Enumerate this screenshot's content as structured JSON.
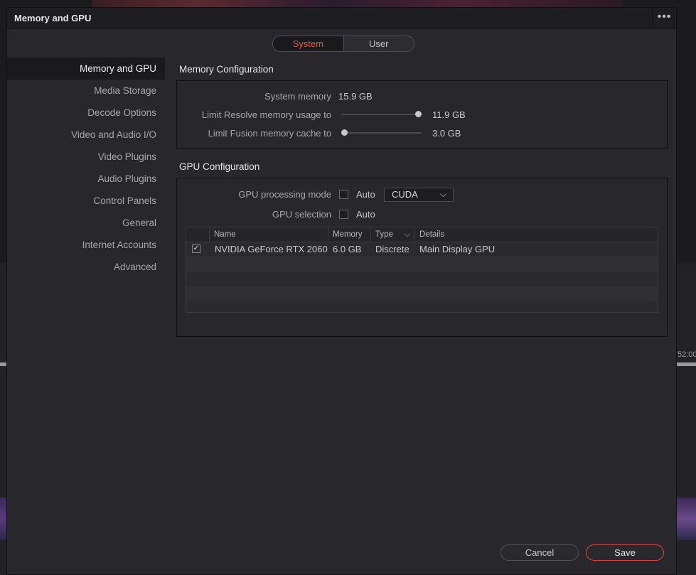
{
  "dialog": {
    "title": "Memory and GPU",
    "menu_icon": "more-dots-icon",
    "tabs": [
      {
        "label": "System",
        "active": true
      },
      {
        "label": "User",
        "active": false
      }
    ]
  },
  "sidebar": {
    "items": [
      {
        "label": "Memory and GPU",
        "selected": true
      },
      {
        "label": "Media Storage"
      },
      {
        "label": "Decode Options"
      },
      {
        "label": "Video and Audio I/O"
      },
      {
        "label": "Video Plugins"
      },
      {
        "label": "Audio Plugins"
      },
      {
        "label": "Control Panels"
      },
      {
        "label": "General"
      },
      {
        "label": "Internet Accounts"
      },
      {
        "label": "Advanced"
      }
    ]
  },
  "memory": {
    "section_title": "Memory Configuration",
    "system_memory_label": "System memory",
    "system_memory_value": "15.9 GB",
    "limit_resolve_label": "Limit Resolve memory usage to",
    "limit_resolve_value": "11.9 GB",
    "limit_resolve_fraction": 1.0,
    "limit_fusion_label": "Limit Fusion memory cache to",
    "limit_fusion_value": "3.0 GB",
    "limit_fusion_fraction": 0.0
  },
  "gpu": {
    "section_title": "GPU Configuration",
    "processing_mode_label": "GPU processing mode",
    "processing_mode_auto_label": "Auto",
    "processing_mode_auto_checked": false,
    "processing_mode_value": "CUDA",
    "selection_label": "GPU selection",
    "selection_auto_label": "Auto",
    "selection_auto_checked": false,
    "table": {
      "columns": [
        "Name",
        "Memory",
        "Type",
        "Details"
      ],
      "rows": [
        {
          "checked": true,
          "name": "NVIDIA GeForce RTX 2060",
          "memory": "6.0 GB",
          "type": "Discrete",
          "details": "Main Display GPU"
        }
      ]
    }
  },
  "footer": {
    "cancel_label": "Cancel",
    "save_label": "Save"
  },
  "background": {
    "timecode_right": "52:00"
  },
  "colors": {
    "accent": "#e8533f",
    "save_border": "#d9463c",
    "dialog_bg": "#28282c"
  }
}
